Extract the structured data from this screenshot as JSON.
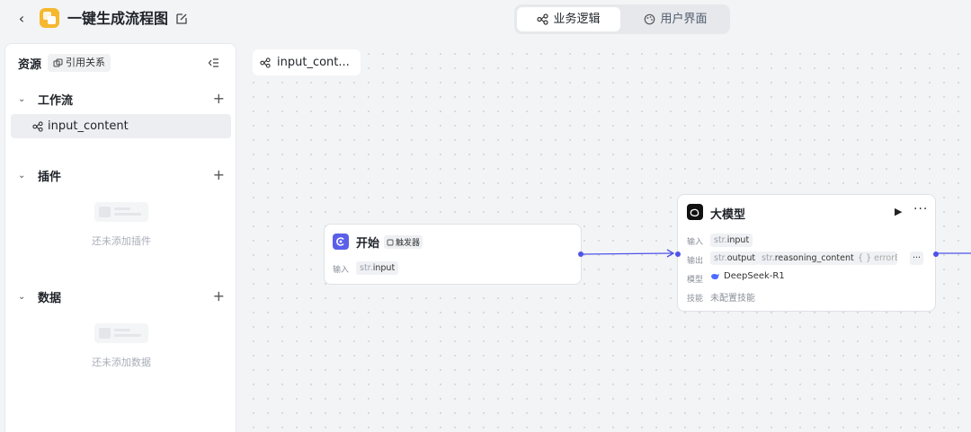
{
  "header": {
    "app_title": "一键生成流程图",
    "tabs": [
      {
        "label": "业务逻辑",
        "active": true
      },
      {
        "label": "用户界面",
        "active": false
      }
    ]
  },
  "sidebar": {
    "title": "资源",
    "ref_button": "引用关系",
    "sections": [
      {
        "title": "工作流",
        "items": [
          "input_content"
        ]
      },
      {
        "title": "插件",
        "empty_text": "还未添加插件"
      },
      {
        "title": "数据",
        "empty_text": "还未添加数据"
      }
    ]
  },
  "canvas": {
    "tab_label": "input_cont...",
    "nodes": {
      "start": {
        "title": "开始",
        "badge": "触发器",
        "input_label": "输入",
        "input_type": "str.",
        "input_name": "input"
      },
      "llm": {
        "title": "大模型",
        "input_label": "输入",
        "input_type": "str.",
        "input_name": "input",
        "output_label": "输出",
        "outputs": [
          {
            "type": "str.",
            "name": "output"
          },
          {
            "type": "str.",
            "name": "reasoning_content"
          },
          {
            "type": "{ }",
            "name": "errorB"
          }
        ],
        "model_label": "模型",
        "model_name": "DeepSeek-R1",
        "skill_label": "技能",
        "skill_value": "未配置技能"
      }
    }
  },
  "colors": {
    "accent": "#4d53e8",
    "app_logo": "#f5b82e",
    "start_icon": "#5b5fe8"
  }
}
